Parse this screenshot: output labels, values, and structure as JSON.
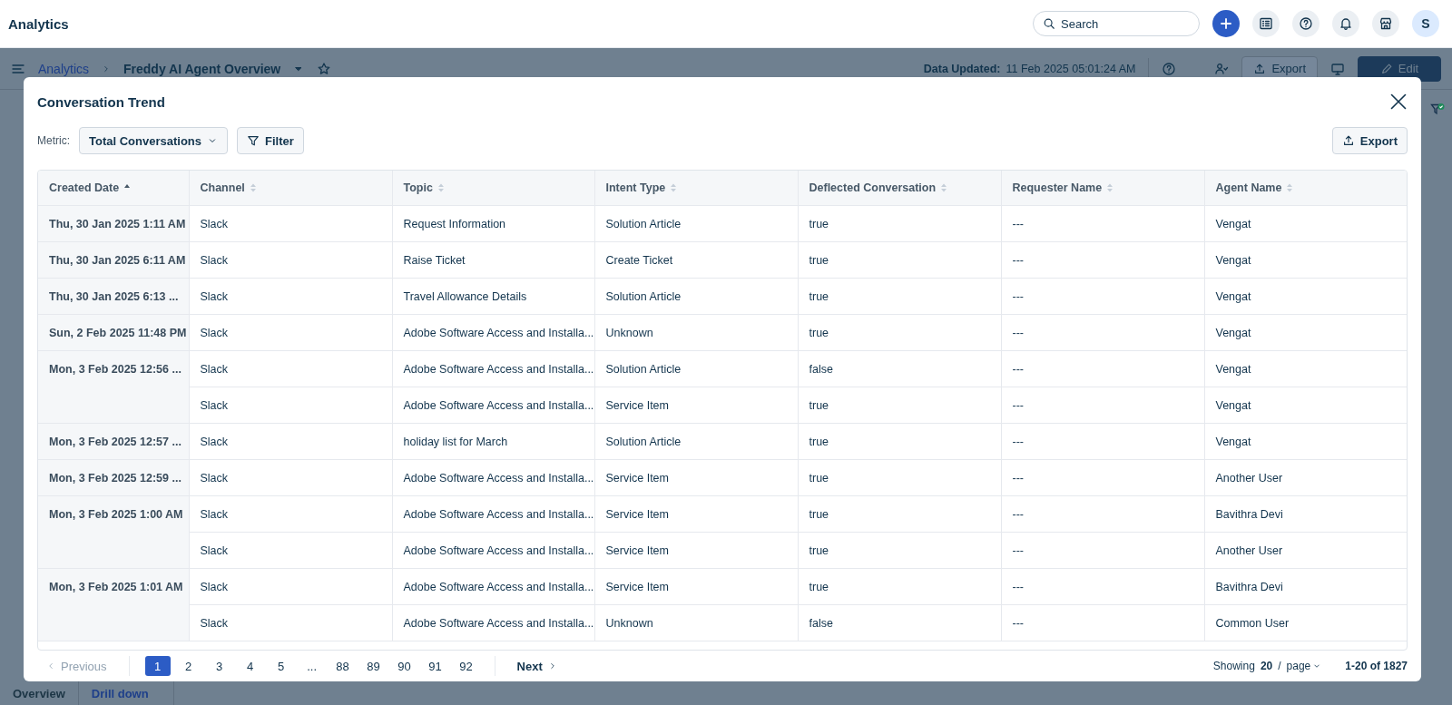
{
  "top_bar": {
    "title": "Analytics",
    "search": {
      "placeholder": "Search"
    },
    "avatar": "S"
  },
  "page_header": {
    "breadcrumb": [
      {
        "label": "Analytics",
        "kind": "link"
      },
      {
        "label": "Freddy AI Agent Overview",
        "kind": "current"
      }
    ],
    "data_updated_label": "Data Updated:",
    "data_updated_value": "11 Feb 2025 05:01:24 AM",
    "export_label": "Export",
    "edit_label": "Edit"
  },
  "bottom_tabs": [
    {
      "label": "Overview",
      "selected": false
    },
    {
      "label": "Drill down",
      "selected": true
    }
  ],
  "modal": {
    "title": "Conversation Trend",
    "metric_label": "Metric:",
    "metric_value": "Total Conversations",
    "filter_label": "Filter",
    "export_label": "Export",
    "table": {
      "columns": [
        {
          "label": "Created Date",
          "sorted": true
        },
        {
          "label": "Channel",
          "sorted": false
        },
        {
          "label": "Topic",
          "sorted": false
        },
        {
          "label": "Intent Type",
          "sorted": false
        },
        {
          "label": "Deflected Conversation",
          "sorted": false
        },
        {
          "label": "Requester Name",
          "sorted": false
        },
        {
          "label": "Agent Name",
          "sorted": false
        }
      ],
      "groups": [
        {
          "date": "Thu, 30 Jan 2025 1:11 AM",
          "rows": [
            [
              "Slack",
              "Request Information",
              "Solution Article",
              "true",
              "---",
              "Vengat"
            ]
          ]
        },
        {
          "date": "Thu, 30 Jan 2025 6:11 AM",
          "rows": [
            [
              "Slack",
              "Raise Ticket",
              "Create Ticket",
              "true",
              "---",
              "Vengat"
            ]
          ]
        },
        {
          "date": "Thu, 30 Jan 2025 6:13 ...",
          "rows": [
            [
              "Slack",
              "Travel Allowance Details",
              "Solution Article",
              "true",
              "---",
              "Vengat"
            ]
          ]
        },
        {
          "date": "Sun, 2 Feb 2025 11:48 PM",
          "rows": [
            [
              "Slack",
              "Adobe Software Access and Installa...",
              "Unknown",
              "true",
              "---",
              "Vengat"
            ]
          ]
        },
        {
          "date": "Mon, 3 Feb 2025 12:56 ...",
          "rows": [
            [
              "Slack",
              "Adobe Software Access and Installa...",
              "Solution Article",
              "false",
              "---",
              "Vengat"
            ],
            [
              "Slack",
              "Adobe Software Access and Installa...",
              "Service Item",
              "true",
              "---",
              "Vengat"
            ]
          ]
        },
        {
          "date": "Mon, 3 Feb 2025 12:57 ...",
          "rows": [
            [
              "Slack",
              "holiday list for March",
              "Solution Article",
              "true",
              "---",
              "Vengat"
            ]
          ]
        },
        {
          "date": "Mon, 3 Feb 2025 12:59 ...",
          "rows": [
            [
              "Slack",
              "Adobe Software Access and Installa...",
              "Service Item",
              "true",
              "---",
              "Another User"
            ]
          ]
        },
        {
          "date": "Mon, 3 Feb 2025 1:00 AM",
          "rows": [
            [
              "Slack",
              "Adobe Software Access and Installa...",
              "Service Item",
              "true",
              "---",
              "Bavithra Devi"
            ],
            [
              "Slack",
              "Adobe Software Access and Installa...",
              "Service Item",
              "true",
              "---",
              "Another User"
            ]
          ]
        },
        {
          "date": "Mon, 3 Feb 2025 1:01 AM",
          "rows": [
            [
              "Slack",
              "Adobe Software Access and Installa...",
              "Service Item",
              "true",
              "---",
              "Bavithra Devi"
            ],
            [
              "Slack",
              "Adobe Software Access and Installa...",
              "Unknown",
              "false",
              "---",
              "Common User"
            ]
          ]
        }
      ]
    },
    "pagination": {
      "previous": {
        "label": "Previous",
        "disabled": true
      },
      "pages": [
        {
          "label": "1",
          "selected": true
        },
        {
          "label": "2",
          "selected": false
        },
        {
          "label": "3",
          "selected": false
        },
        {
          "label": "4",
          "selected": false
        },
        {
          "label": "5",
          "selected": false
        },
        {
          "label": "...",
          "selected": false
        },
        {
          "label": "88",
          "selected": false
        },
        {
          "label": "89",
          "selected": false
        },
        {
          "label": "90",
          "selected": false
        },
        {
          "label": "91",
          "selected": false
        },
        {
          "label": "92",
          "selected": false
        }
      ],
      "next": {
        "label": "Next",
        "disabled": false
      },
      "showing_label": "Showing",
      "page_size": "20",
      "per_page_label": "/",
      "page_label": "page",
      "range": "1-20 of 1827"
    }
  }
}
